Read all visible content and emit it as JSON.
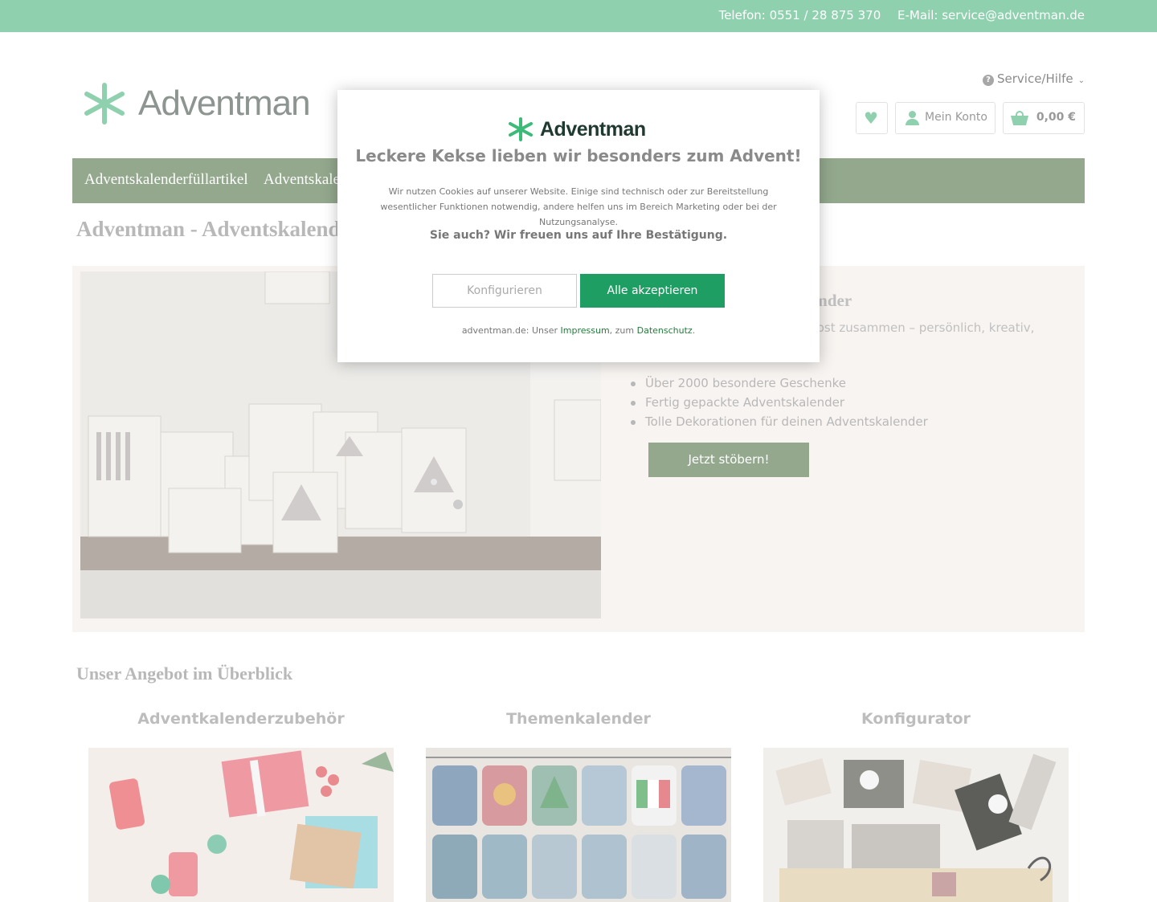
{
  "topbar": {
    "phone": "Telefon: 0551 / 28 875 370",
    "email": "E-Mail: service@adventman.de"
  },
  "logo": {
    "text": "Adventman",
    "icon": "asterisk-logo-icon"
  },
  "header": {
    "service_label": "Service/Hilfe",
    "account_label": "Mein Konto",
    "cart_total": "0,00 €",
    "icons": [
      "question-icon",
      "heart-icon",
      "user-icon",
      "basket-icon",
      "chevron-down-icon"
    ]
  },
  "nav": {
    "items": [
      "Adventskalenderfüllartikel",
      "Adventskalender"
    ]
  },
  "page_title": "Adventman - Adventskalender",
  "hero": {
    "title": "lender",
    "text": "elbst zusammen – persönlich, kreativ,",
    "bullets": [
      "Über 2000 besondere Geschenke",
      "Fertig gepackte Adventskalender",
      "Tolle Dekorationen für deinen Adventskalender"
    ],
    "cta": "Jetzt stöbern!"
  },
  "offer": {
    "title": "Unser Angebot im Überblick",
    "cards": [
      "Adventkalenderzubehör",
      "Themenkalender",
      "Konfigurator"
    ]
  },
  "cookie_modal": {
    "logo_text": "Adventman",
    "heading": "Leckere Kekse lieben wir besonders zum Advent!",
    "text": "Wir nutzen Cookies auf unserer Website. Einige sind technisch oder zur Bereitstellung wesentlicher Funktionen notwendig, andere helfen uns im Bereich Marketing oder bei der Nutzungsanalyse.",
    "question": "Sie auch? Wir freuen uns auf Ihre Bestätigung.",
    "configure_label": "Konfigurieren",
    "accept_label": "Alle akzeptieren",
    "footer_prefix": "adventman.de: Unser ",
    "footer_impressum": "Impressum",
    "footer_middle": ", zum ",
    "footer_datenschutz": "Datenschutz",
    "footer_suffix": "."
  },
  "colors": {
    "topbar": "#8fd0ae",
    "nav": "#93a88d",
    "accept_button": "#1f9e63",
    "brand_green": "#3cba78"
  }
}
